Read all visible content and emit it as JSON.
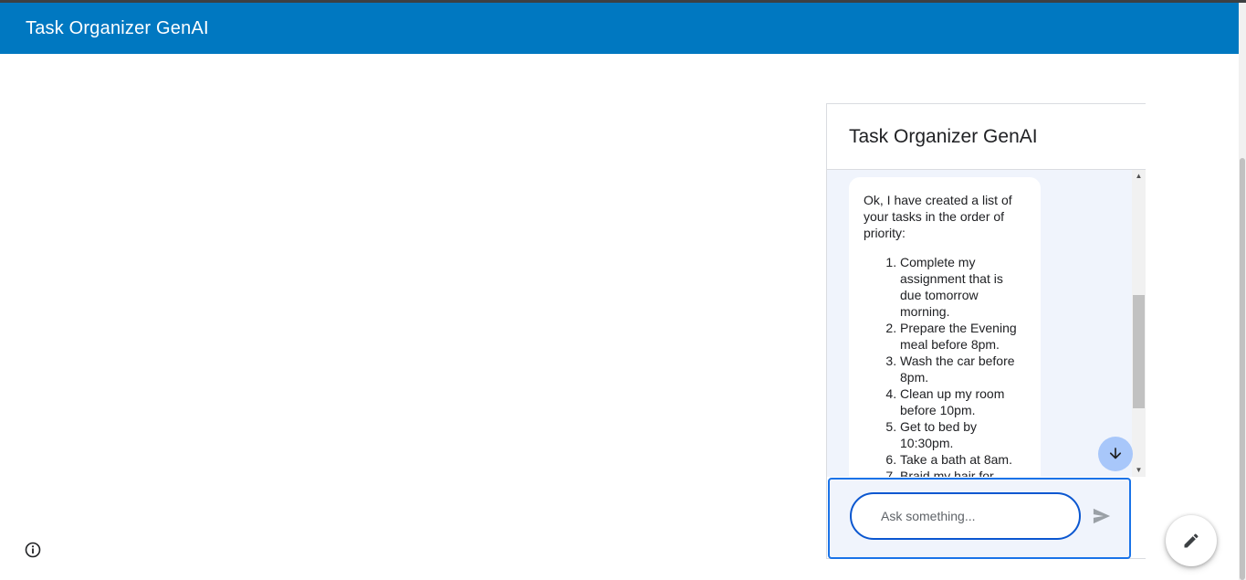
{
  "app": {
    "title": "Task Organizer GenAI"
  },
  "chat": {
    "title": "Task Organizer GenAI",
    "message": {
      "intro": "Ok, I have created a list of your tasks in the order of priority:",
      "items": [
        "Complete my assignment that is due tomorrow morning.",
        "Prepare the Evening meal before 8pm.",
        "Wash the car before 8pm.",
        "Clean up my room before 10pm.",
        "Get to bed by 10:30pm.",
        "Take a bath at 8am.",
        "Braid my hair for"
      ]
    },
    "input": {
      "placeholder": "Ask something...",
      "value": ""
    },
    "icons": {
      "send": "send-icon",
      "scroll_down": "arrow-down-icon"
    }
  },
  "page_icons": {
    "info": "info-icon",
    "edit": "pencil-icon"
  },
  "colors": {
    "header": "#0078c1",
    "accent": "#1a73e8",
    "chat_bg": "#f0f4fc",
    "scroll_button": "#a8c7fa"
  }
}
